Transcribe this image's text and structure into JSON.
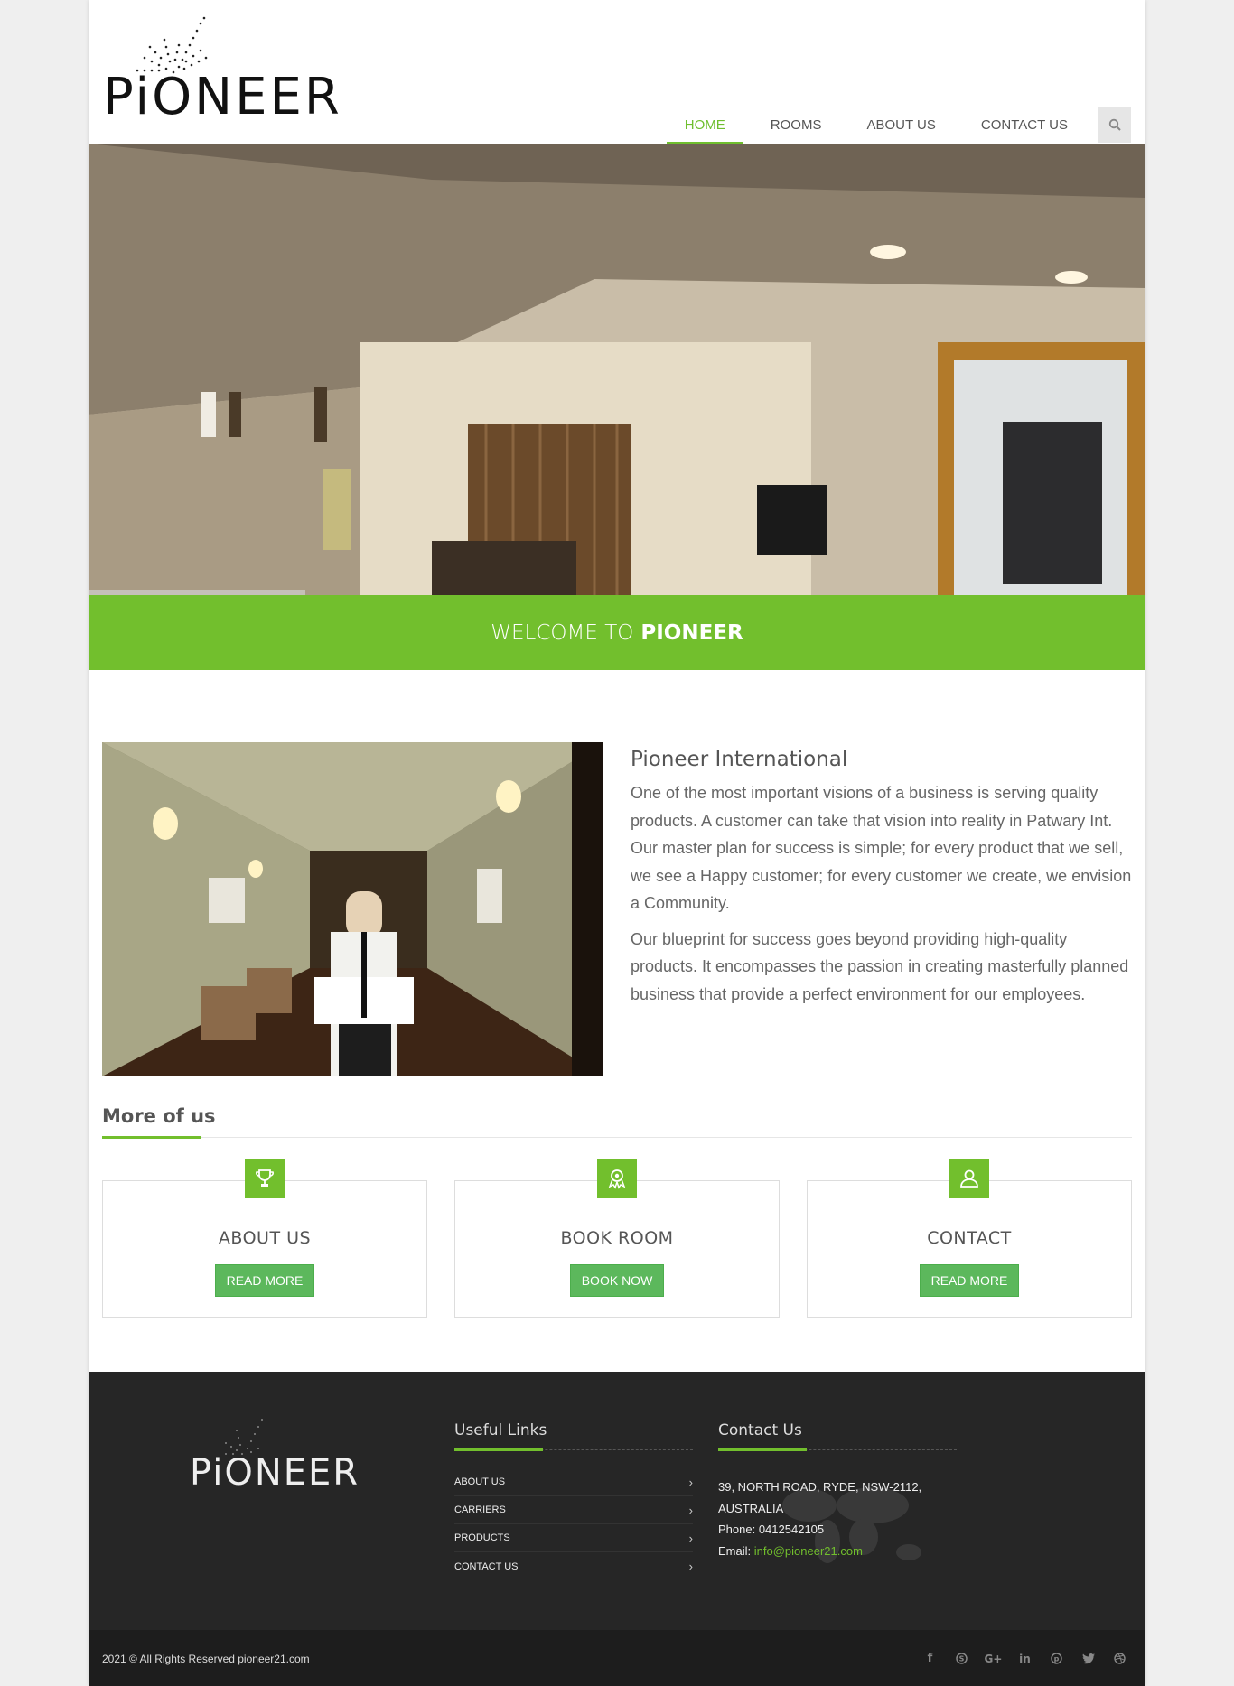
{
  "brand": {
    "name": "PiONEER"
  },
  "nav": {
    "items": [
      {
        "label": "HOME",
        "active": true
      },
      {
        "label": "ROOMS",
        "active": false
      },
      {
        "label": "ABOUT US",
        "active": false
      },
      {
        "label": "CONTACT US",
        "active": false
      }
    ],
    "search_icon": "search-icon"
  },
  "banner": {
    "prefix": "WELCOME TO",
    "emphasis": "PIONEER"
  },
  "intro": {
    "title": "Pioneer International",
    "paragraphs": [
      "One of the most important visions of a business is serving quality products. A customer can take that vision into reality in Patwary Int. Our master plan for success is simple; for every product that we sell, we see a Happy customer; for every customer we create, we envision a Community.",
      "Our blueprint for success goes beyond providing high-quality products. It encompasses the passion in creating masterfully planned business that provide a perfect environment for our employees."
    ]
  },
  "more": {
    "title": "More of us",
    "boxes": [
      {
        "icon": "trophy-icon",
        "title": "ABOUT US",
        "button": "READ MORE"
      },
      {
        "icon": "award-icon",
        "title": "BOOK ROOM",
        "button": "BOOK NOW"
      },
      {
        "icon": "user-icon",
        "title": "CONTACT",
        "button": "READ MORE"
      }
    ]
  },
  "footer": {
    "links_title": "Useful Links",
    "links": [
      "ABOUT US",
      "CARRIERS",
      "PRODUCTS",
      "CONTACT US"
    ],
    "contact_title": "Contact Us",
    "address_line1": "39, NORTH ROAD, RYDE, NSW-2112,",
    "address_line2": "AUSTRALIA",
    "phone_label": "Phone:",
    "phone": "0412542105",
    "email_label": "Email:",
    "email": "info@pioneer21.com",
    "copyright": "2021 © All Rights Reserved pioneer21.com",
    "social": [
      "facebook-icon",
      "skype-icon",
      "google-plus-icon",
      "linkedin-icon",
      "pinterest-icon",
      "twitter-icon",
      "dribbble-icon"
    ]
  },
  "colors": {
    "accent": "#72bf2d",
    "button": "#5cb85c",
    "footer": "#262626"
  }
}
